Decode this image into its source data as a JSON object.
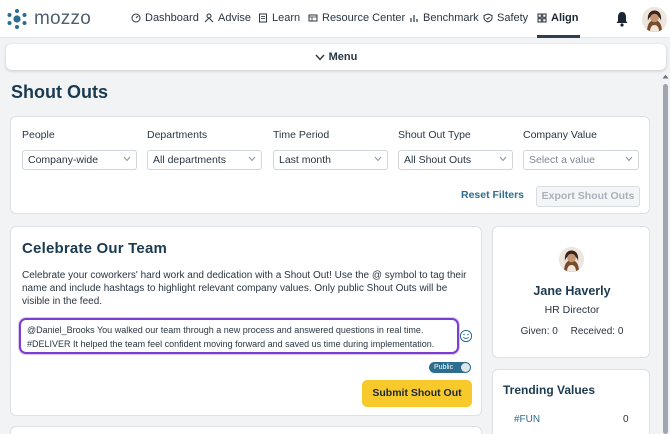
{
  "brand": {
    "logo_text": "mozzo",
    "accent": "#2c6e8f",
    "highlight": "#7a3fd1",
    "cta_color": "#f7c92b"
  },
  "nav": {
    "items": [
      {
        "label": "Dashboard",
        "icon": "dashboard-icon"
      },
      {
        "label": "Advise",
        "icon": "advise-icon"
      },
      {
        "label": "Learn",
        "icon": "learn-icon"
      },
      {
        "label": "Resource Center",
        "icon": "resource-center-icon"
      },
      {
        "label": "Benchmark",
        "icon": "benchmark-icon"
      },
      {
        "label": "Safety",
        "icon": "safety-icon"
      },
      {
        "label": "Align",
        "icon": "align-icon",
        "active": true
      }
    ],
    "bell_icon": "bell-icon"
  },
  "menu": {
    "label": "Menu",
    "icon": "chevron-down-icon"
  },
  "page": {
    "title": "Shout Outs"
  },
  "filters": {
    "people": {
      "label": "People",
      "value": "Company-wide"
    },
    "departments": {
      "label": "Departments",
      "value": "All departments"
    },
    "time_period": {
      "label": "Time Period",
      "value": "Last month"
    },
    "shout_out_type": {
      "label": "Shout Out Type",
      "value": "All Shout Outs"
    },
    "company_value": {
      "label": "Company Value",
      "placeholder": "Select a value"
    },
    "reset_label": "Reset Filters",
    "export_label": "Export Shout Outs"
  },
  "celebrate": {
    "title": "Celebrate Our Team",
    "description": "Celebrate your coworkers' hard work and dedication with a Shout Out! Use the @ symbol to tag their name and include hashtags to highlight relevant company values. Only public Shout Outs will be visible in the feed.",
    "input_line1": "@Daniel_Brooks You walked our team through a new process and answered questions in real time.",
    "input_line2": "#DELIVER It helped the team feel confident moving forward and saved us time during implementation.",
    "visibility_label": "Public",
    "submit_label": "Submit Shout Out"
  },
  "profile": {
    "name": "Jane Haverly",
    "role": "HR Director",
    "given": "Given: 0",
    "received": "Received: 0"
  },
  "trending": {
    "title": "Trending Values",
    "items": [
      {
        "name": "#FUN",
        "count": "0"
      }
    ]
  }
}
